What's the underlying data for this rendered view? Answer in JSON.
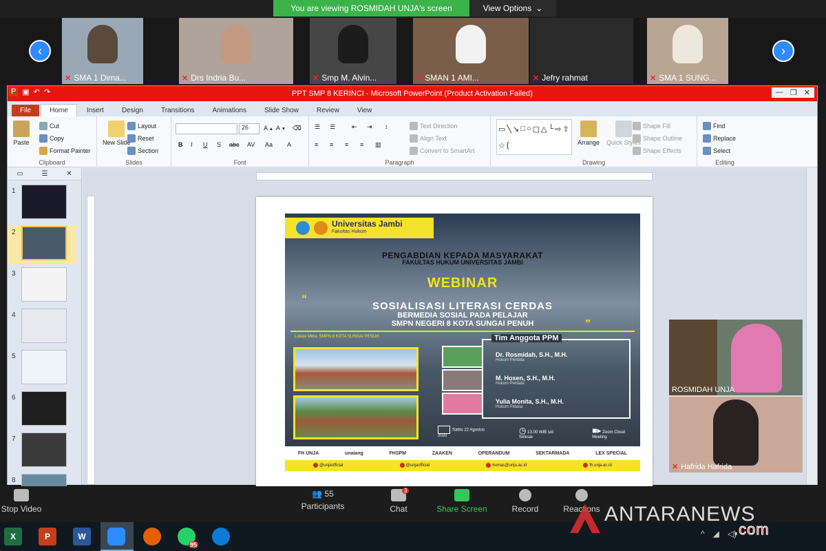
{
  "zoom": {
    "banner_text": "You are viewing ROSMIDAH UNJA's screen",
    "view_options": "View Options",
    "chevron": "⌄",
    "gallery": [
      {
        "name": "SMA 1 Dima...",
        "face_color": "#5a4a3e",
        "bg": "#9aa8b5"
      },
      {
        "name": "Drs Indria Bu...",
        "face_color": "#c49a82",
        "bg": "#b0a39b"
      },
      {
        "name": "Smp M. Alvin...",
        "face_color": "#1c1c1c",
        "bg": "#464646"
      },
      {
        "name": "SMAN 1 AMI...",
        "face_color": "#f2f2f2",
        "bg": "#7a5e4a"
      },
      {
        "name": "Jefry rahmat",
        "face_color": "#2a2a2a",
        "bg": "#2a2a2a"
      },
      {
        "name": "SMA 1 SUNG...",
        "face_color": "#ede7dc",
        "bg": "#b8a592"
      }
    ],
    "prev_arrow": "‹",
    "next_arrow": "›",
    "side_videos": [
      {
        "name": "ROSMIDAH UNJA",
        "bg": "#6a7a6a",
        "face": "#e07ab0"
      },
      {
        "name": "Hafrida Hafrida",
        "bg": "#c9a89a",
        "face": "#2a2222"
      }
    ],
    "toolbar": {
      "stop_video": "Stop Video",
      "participants_count": "55",
      "participants": "Participants",
      "chat": "Chat",
      "chat_badge": "3",
      "share_screen": "Share Screen",
      "record": "Record",
      "reactions": "Reactions"
    }
  },
  "ppt": {
    "title": "PPT SMP 8 KERINCI - Microsoft PowerPoint (Product Activation Failed)",
    "tabs": [
      "File",
      "Home",
      "Insert",
      "Design",
      "Transitions",
      "Animations",
      "Slide Show",
      "Review",
      "View"
    ],
    "clipboard": {
      "paste": "Paste",
      "cut": "Cut",
      "copy": "Copy",
      "format_painter": "Format Painter",
      "label": "Clipboard"
    },
    "slides_group": {
      "new_slide": "New Slide",
      "layout": "Layout",
      "reset": "Reset",
      "section": "Section",
      "label": "Slides"
    },
    "font_group": {
      "size": "26",
      "label": "Font"
    },
    "paragraph_group": {
      "text_direction": "Text Direction",
      "align_text": "Align Text",
      "convert": "Convert to SmartArt",
      "label": "Paragraph"
    },
    "drawing_group": {
      "arrange": "Arrange",
      "quick_styles": "Quick Styles",
      "shape_fill": "Shape Fill",
      "shape_outline": "Shape Outline",
      "shape_effects": "Shape Effects",
      "label": "Drawing"
    },
    "editing_group": {
      "find": "Find",
      "replace": "Replace",
      "select": "Select",
      "label": "Editing"
    },
    "slide_numbers": [
      "1",
      "2",
      "3",
      "4",
      "5",
      "6",
      "7",
      "8"
    ],
    "selected_slide": 2
  },
  "poster": {
    "university": "Universitas Jambi",
    "faculty": "Fakultas Hukum",
    "ppm": "PENGABDIAN KEPADA MASYARAKAT",
    "ppm_sub": "FAKULTAS HUKUM UNIVERSITAS JAMBI",
    "webinar": "WEBINAR",
    "title": "SOSIALISASI LITERASI CERDAS",
    "sub1": "BERMEDIA SOSIAL PADA PELAJAR",
    "sub2": "SMPN NEGERI 8 KOTA SUNGAI PENUH",
    "lokasi": "Lokasi Mitra: SMPN 8 KOTA SUNGAI PENUH",
    "team_title": "Tim Anggota PPM",
    "members": [
      {
        "name": "Dr. Rosmidah, S.H., M.H.",
        "role": "Hukum Perdata"
      },
      {
        "name": "M. Hosen, S.H., M.H.",
        "role": "Hukum Perdata"
      },
      {
        "name": "Yulia Monita, S.H., M.H.",
        "role": "Hukum Pidana"
      }
    ],
    "info": [
      "Sabtu 22 Agustus 2020",
      "13.00 WIB s/d Selesai",
      "Zoom Cloud Meeting"
    ],
    "sponsors": [
      "FH UNJA",
      "unaiang",
      "FHSPM",
      "ZAAKEN",
      "OPERANDUM",
      "SEKTARMADA",
      "LEX SPECIAL"
    ],
    "social": [
      "@unjaofficial",
      "@unjaofficial",
      "humas@unja.ac.id",
      "fh.unja.ac.id"
    ]
  },
  "watermark": {
    "main": "ANTARANEWS",
    "com": ".com"
  },
  "taskbar": {
    "excel": "X",
    "ppt": "P",
    "word": "W",
    "whatsapp_badge": "95"
  }
}
